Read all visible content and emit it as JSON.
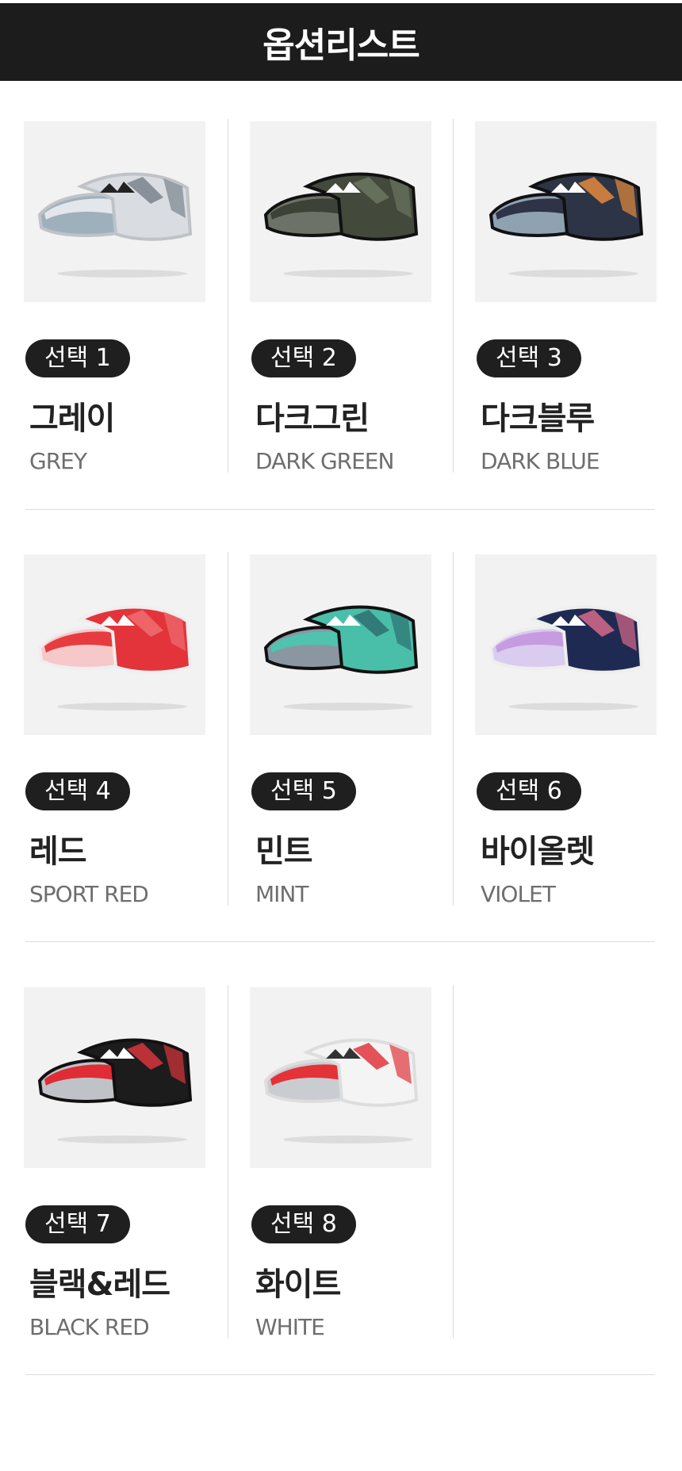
{
  "header": {
    "title": "옵션리스트"
  },
  "options": [
    {
      "badge": "선택 1",
      "name_ko": "그레이",
      "name_en": "GREY",
      "colors": {
        "crown": "#d9dde2",
        "crown_pattern": "#7b838c",
        "brim_top": "#e3e6ea",
        "brim_under": "#9fb0bd",
        "trim": "#bfc3c7",
        "logo": "#222222"
      }
    },
    {
      "badge": "선택 2",
      "name_ko": "다크그린",
      "name_en": "DARK GREEN",
      "colors": {
        "crown": "#434a3c",
        "crown_pattern": "#6b7560",
        "brim_top": "#3d4236",
        "brim_under": "#6c7268",
        "trim": "#111111",
        "logo": "#ffffff"
      }
    },
    {
      "badge": "선택 3",
      "name_ko": "다크블루",
      "name_en": "DARK BLUE",
      "colors": {
        "crown": "#2d3446",
        "crown_pattern": "#e48a3c",
        "brim_top": "#2e3347",
        "brim_under": "#8fa2b2",
        "trim": "#111111",
        "logo": "#ffffff"
      }
    },
    {
      "badge": "선택 4",
      "name_ko": "레드",
      "name_en": "SPORT RED",
      "colors": {
        "crown": "#e2343a",
        "crown_pattern": "#f06e72",
        "brim_top": "#e63c40",
        "brim_under": "#f7c8c9",
        "trim": "#eeeeee",
        "logo": "#ffffff"
      }
    },
    {
      "badge": "선택 5",
      "name_ko": "민트",
      "name_en": "MINT",
      "colors": {
        "crown": "#49bfa9",
        "crown_pattern": "#2e6f72",
        "brim_top": "#4fc3ad",
        "brim_under": "#8a97a3",
        "trim": "#111111",
        "logo": "#ffffff"
      }
    },
    {
      "badge": "선택 6",
      "name_ko": "바이올렛",
      "name_en": "VIOLET",
      "colors": {
        "crown": "#1f2a52",
        "crown_pattern": "#d86a8a",
        "brim_top": "#c79be0",
        "brim_under": "#d9ccef",
        "trim": "#eeeeee",
        "logo": "#ffffff"
      }
    },
    {
      "badge": "선택 7",
      "name_ko": "블랙&레드",
      "name_en": "BLACK RED",
      "colors": {
        "crown": "#1c1c1c",
        "crown_pattern": "#d8343c",
        "brim_top": "#e02c34",
        "brim_under": "#bfc3c7",
        "trim": "#111111",
        "logo": "#ffffff"
      }
    },
    {
      "badge": "선택 8",
      "name_ko": "화이트",
      "name_en": "WHITE",
      "colors": {
        "crown": "#f4f4f4",
        "crown_pattern": "#e0343c",
        "brim_top": "#e33238",
        "brim_under": "#c9ccd0",
        "trim": "#dddddd",
        "logo": "#333333"
      }
    }
  ]
}
